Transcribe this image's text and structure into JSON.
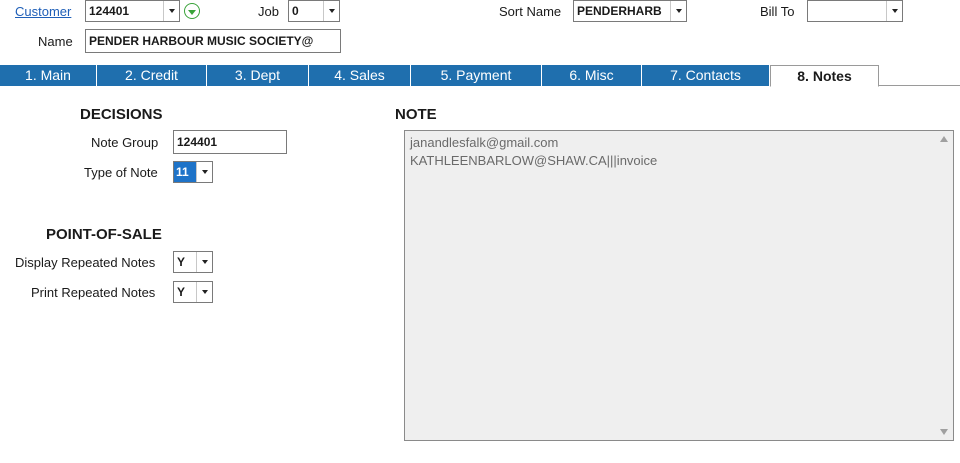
{
  "header": {
    "customer_label": "Customer",
    "customer_value": "124401",
    "job_label": "Job",
    "job_value": "0",
    "sort_name_label": "Sort Name",
    "sort_name_value": "PENDERHARB",
    "bill_to_label": "Bill To",
    "bill_to_value": "",
    "name_label": "Name",
    "name_value": "PENDER HARBOUR MUSIC SOCIETY@"
  },
  "tabs": [
    {
      "label": "1. Main"
    },
    {
      "label": "2. Credit"
    },
    {
      "label": "3. Dept"
    },
    {
      "label": "4. Sales"
    },
    {
      "label": "5. Payment"
    },
    {
      "label": "6. Misc"
    },
    {
      "label": "7. Contacts"
    },
    {
      "label": "8. Notes",
      "active": true
    }
  ],
  "decisions": {
    "title": "DECISIONS",
    "note_group_label": "Note Group",
    "note_group_value": "124401",
    "type_of_note_label": "Type of Note",
    "type_of_note_value": "11"
  },
  "pos": {
    "title": "POINT-OF-SALE",
    "display_repeated_label": "Display Repeated Notes",
    "display_repeated_value": "Y",
    "print_repeated_label": "Print Repeated Notes",
    "print_repeated_value": "Y"
  },
  "note": {
    "title": "NOTE",
    "lines": [
      "janandlesfalk@gmail.com",
      "KATHLEENBARLOW@SHAW.CA|||invoice"
    ]
  },
  "colors": {
    "tab_bg": "#1f6fae",
    "link": "#1f5fb8",
    "highlight": "#1e73c8",
    "note_bg": "#efefef"
  }
}
